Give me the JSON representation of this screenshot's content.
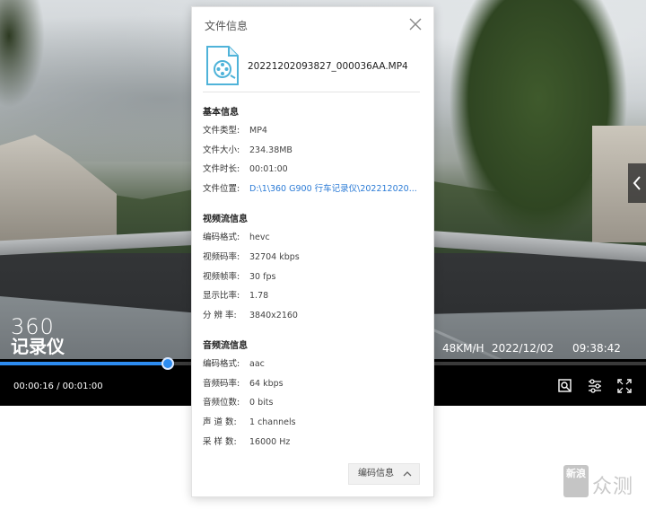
{
  "player": {
    "logo": {
      "number": "360",
      "text": "记录仪"
    },
    "osd": {
      "speed": "48KM/H",
      "date": "2022/12/02",
      "time": "09:38:42"
    },
    "progress": {
      "fraction": 0.26
    },
    "timecode": "00:00:16 / 00:01:00",
    "controls": [
      "screenshot-icon",
      "settings-sliders-icon",
      "fullscreen-icon"
    ]
  },
  "dialog": {
    "title": "文件信息",
    "file_name": "20221202093827_000036AA.MP4",
    "basic": {
      "heading": "基本信息",
      "rows": [
        {
          "label": "文件类型:",
          "value": "MP4"
        },
        {
          "label": "文件大小:",
          "value": "234.38MB"
        },
        {
          "label": "文件时长:",
          "value": "00:01:00"
        },
        {
          "label": "文件位置:",
          "value": "D:\\1\\360 G900 行车记录仪\\202212020...",
          "link": true
        }
      ]
    },
    "video": {
      "heading": "视频流信息",
      "rows": [
        {
          "label": "编码格式:",
          "value": "hevc"
        },
        {
          "label": "视频码率:",
          "value": "32704 kbps"
        },
        {
          "label": "视频帧率:",
          "value": "30 fps"
        },
        {
          "label": "显示比率:",
          "value": "1.78"
        },
        {
          "label": "分 辨 率:",
          "value": "3840x2160"
        }
      ]
    },
    "audio": {
      "heading": "音频流信息",
      "rows": [
        {
          "label": "编码格式:",
          "value": "aac"
        },
        {
          "label": "音频码率:",
          "value": "64 kbps"
        },
        {
          "label": "音频位数:",
          "value": "0 bits"
        },
        {
          "label": "声 道 数:",
          "value": "1 channels"
        },
        {
          "label": "采 样 数:",
          "value": "16000 Hz"
        }
      ]
    },
    "codec_button": "编码信息"
  },
  "watermark": {
    "box_text": "新浪",
    "text": "众测"
  },
  "colors": {
    "accent": "#2d8cf0",
    "link": "#2b7bd6"
  }
}
